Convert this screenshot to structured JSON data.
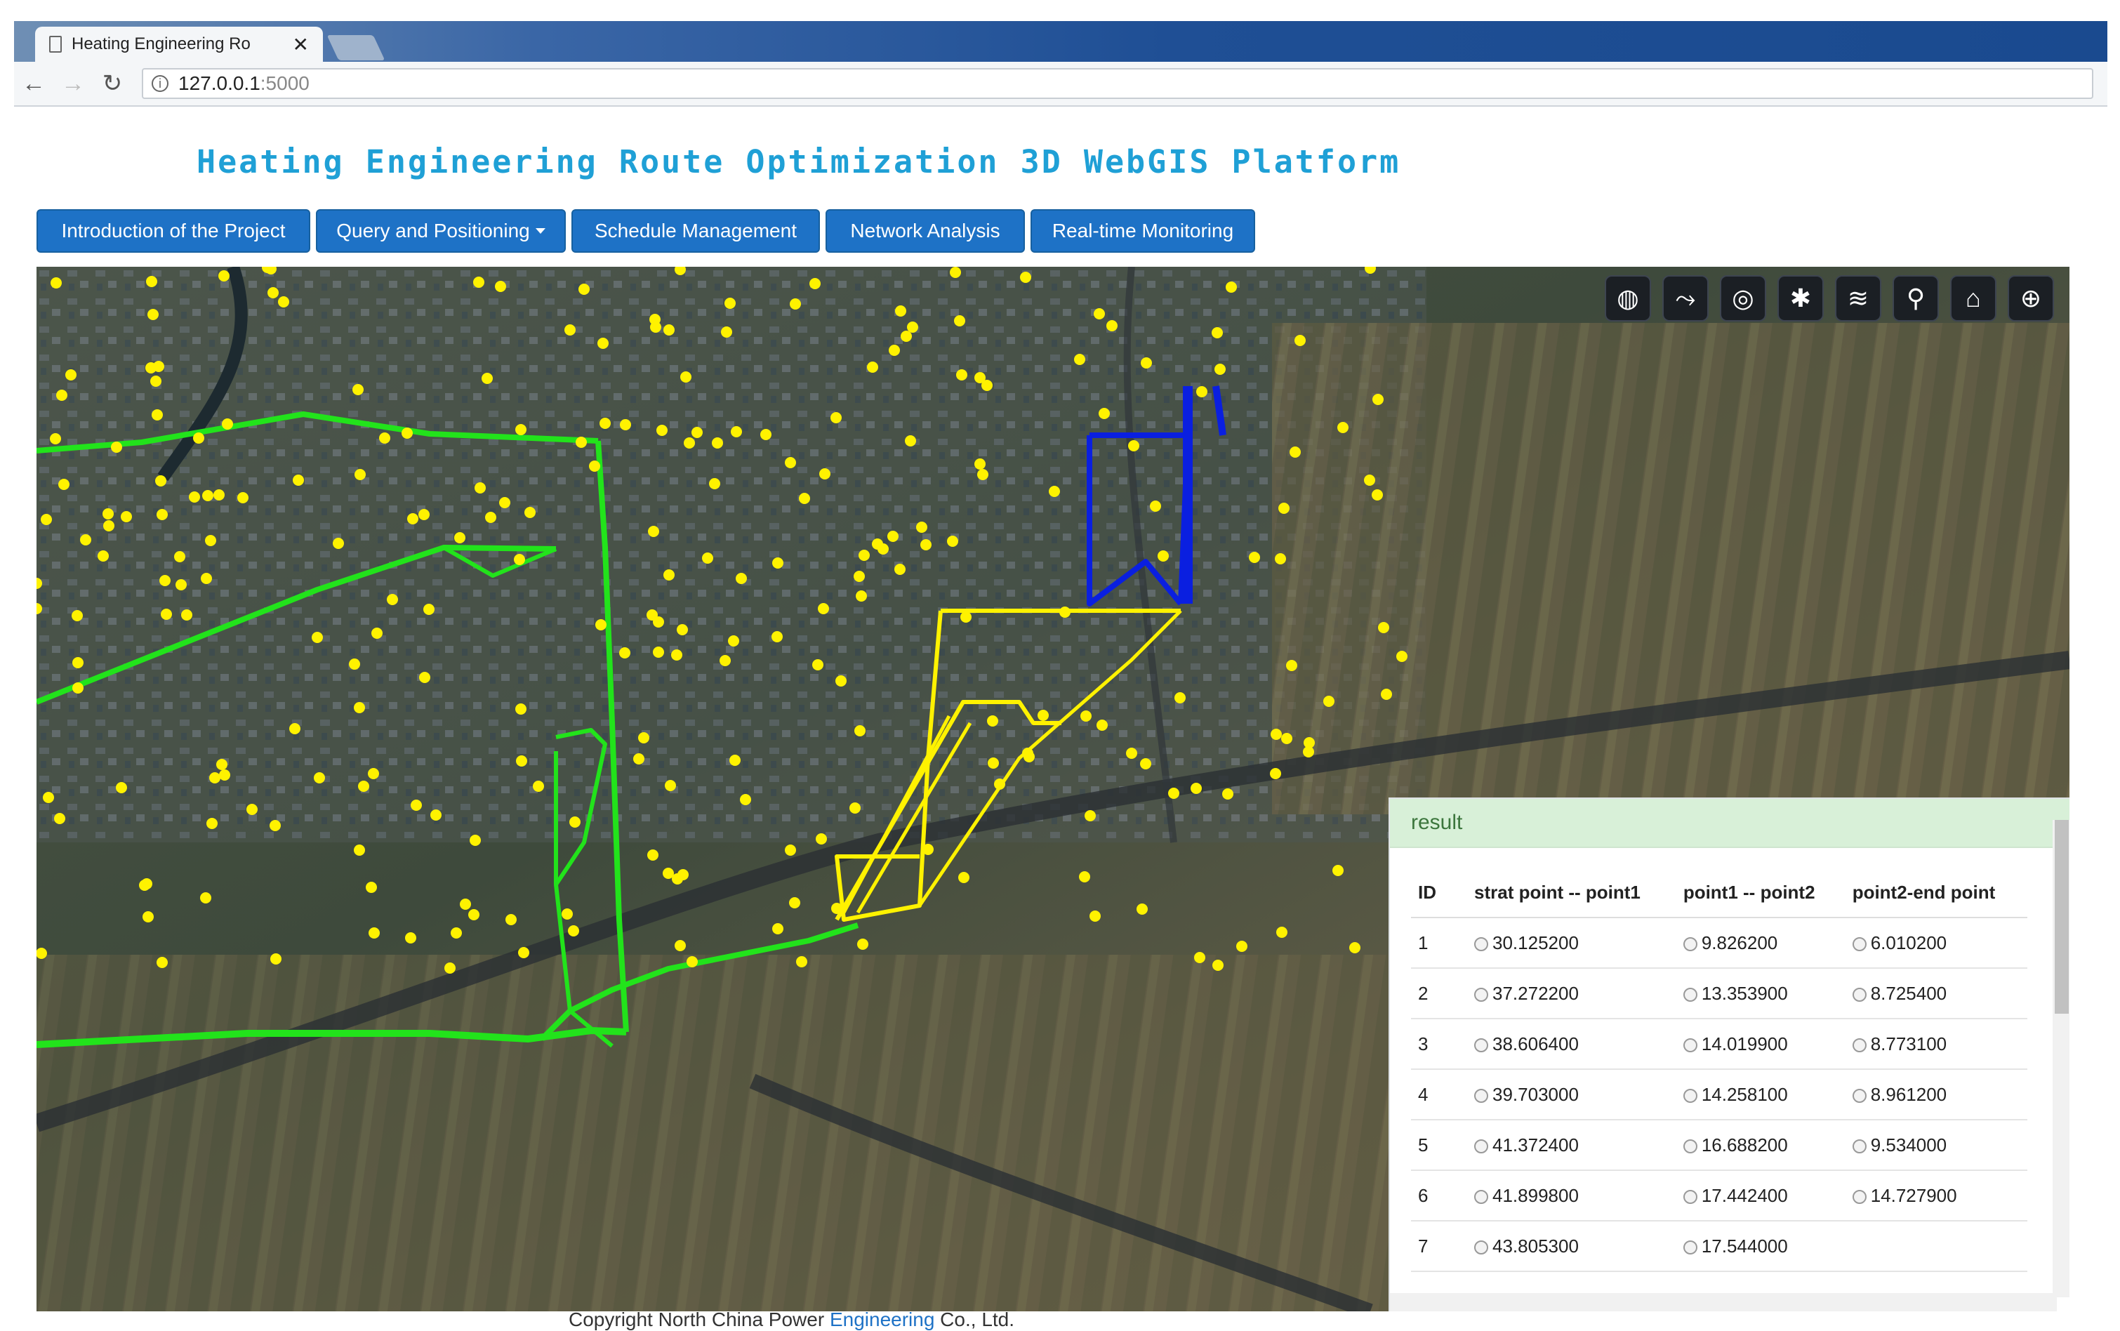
{
  "browser": {
    "tab_title": "Heating Engineering Ro",
    "url_host": "127.0.0.1",
    "url_port": ":5000"
  },
  "page": {
    "title": "Heating Engineering Route Optimization 3D WebGIS Platform"
  },
  "menu": [
    {
      "label": "Introduction of the Project"
    },
    {
      "label": "Query and Positioning"
    },
    {
      "label": "Schedule Management"
    },
    {
      "label": "Network Analysis"
    },
    {
      "label": "Real-time Monitoring"
    }
  ],
  "map_tools": [
    "globe-icon",
    "route-icon",
    "heat-icon",
    "network-icon",
    "layers-icon",
    "search-icon",
    "home-icon",
    "world-icon"
  ],
  "colors": {
    "green_route": "#22e31b",
    "yellow_route": "#fff200",
    "blue_route": "#0a1fe0",
    "node": "#fff200",
    "button": "#1e72c6",
    "title": "#1fa0d6",
    "result_header": "#d8f0d8"
  },
  "result": {
    "header": "result",
    "columns": [
      "ID",
      "strat point -- point1",
      "point1 -- point2",
      "point2-end point"
    ],
    "rows": [
      {
        "id": "1",
        "c1": "30.125200",
        "c2": "9.826200",
        "c3": "6.010200"
      },
      {
        "id": "2",
        "c1": "37.272200",
        "c2": "13.353900",
        "c3": "8.725400"
      },
      {
        "id": "3",
        "c1": "38.606400",
        "c2": "14.019900",
        "c3": "8.773100"
      },
      {
        "id": "4",
        "c1": "39.703000",
        "c2": "14.258100",
        "c3": "8.961200"
      },
      {
        "id": "5",
        "c1": "41.372400",
        "c2": "16.688200",
        "c3": "9.534000"
      },
      {
        "id": "6",
        "c1": "41.899800",
        "c2": "17.442400",
        "c3": "14.727900"
      },
      {
        "id": "7",
        "c1": "43.805300",
        "c2": "17.544000",
        "c3": ""
      }
    ]
  },
  "footer": {
    "text": "Copyright North China Power ",
    "link": "Engineering",
    "text2": " Co., Ltd."
  }
}
